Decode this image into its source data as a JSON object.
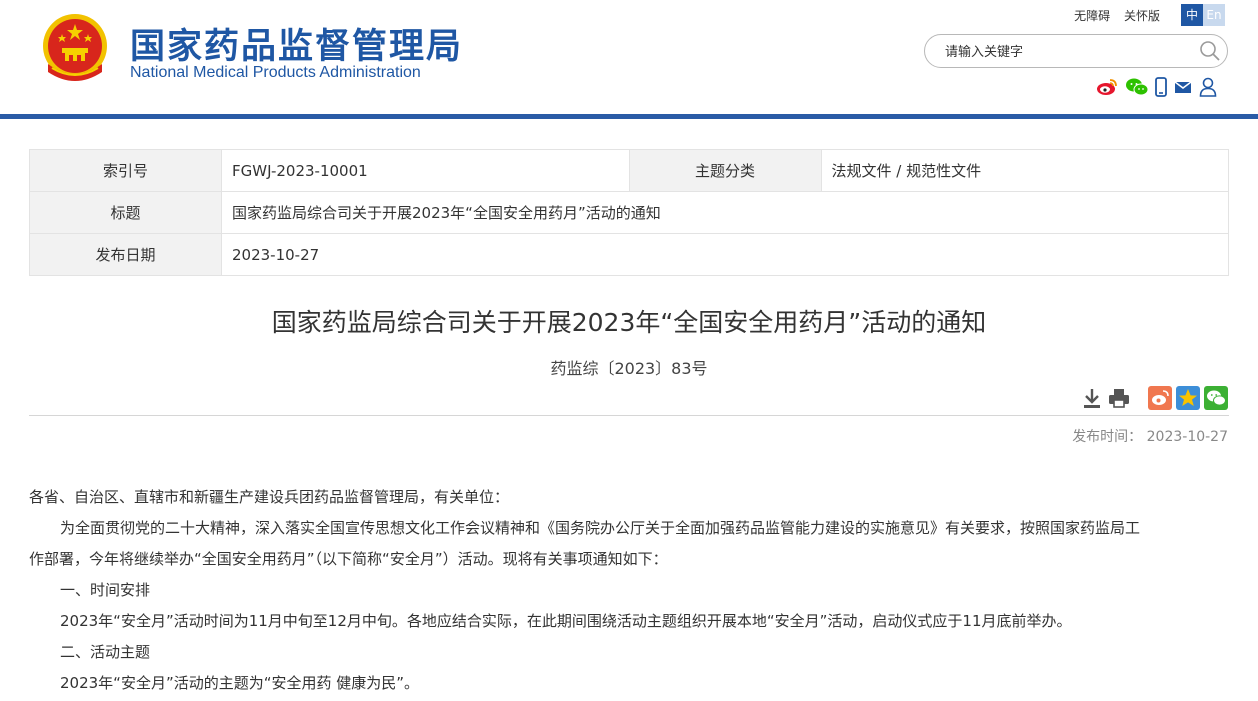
{
  "header": {
    "brand_cn": "国家药品监督管理局",
    "brand_en": "National Medical Products Administration",
    "top_links": [
      "无障碍",
      "关怀版"
    ],
    "lang_zh": "中",
    "lang_en": "En",
    "search_placeholder": "请输入关键字",
    "social_icons": [
      "weibo-icon",
      "wechat-icon",
      "mobile-icon",
      "mail-icon",
      "user-icon"
    ]
  },
  "info": {
    "index_label": "索引号",
    "index_value": "FGWJ-2023-10001",
    "category_label": "主题分类",
    "category_value": "法规文件 / 规范性文件",
    "title_label": "标题",
    "title_value": "国家药监局综合司关于开展2023年“全国安全用药月”活动的通知",
    "date_label": "发布日期",
    "date_value": "2023-10-27"
  },
  "article": {
    "title": "国家药监局综合司关于开展2023年“全国安全用药月”活动的通知",
    "doc_number": "药监综〔2023〕83号",
    "publish_time": "发布时间：  2023-10-27",
    "tools": [
      "download-icon",
      "print-icon",
      "share-weibo-icon",
      "share-qzone-icon",
      "share-wechat-icon"
    ],
    "paragraphs": {
      "p1": "各省、自治区、直辖市和新疆生产建设兵团药品监督管理局，有关单位：",
      "p2a": "为全面贯彻党的二十大精神，深入落实全国宣传思想文化工作会议精神和《国务院办公厅关于全面加强药品监管能力建设的实施意见》有关要求，按照国家药监局工",
      "p2b": "作部署，今年将继续举办“全国安全用药月”（以下简称“安全月”）活动。现将有关事项通知如下：",
      "p3": "一、时间安排",
      "p4": "2023年“安全月”活动时间为11月中旬至12月中旬。各地应结合实际，在此期间围绕活动主题组织开展本地“安全月”活动，启动仪式应于11月底前举办。",
      "p5": "二、活动主题",
      "p6": "2023年“安全月”活动的主题为“安全用药 健康为民”。"
    }
  },
  "colors": {
    "brand_blue": "#1f57a4",
    "header_bar": "#2a5ba6",
    "weibo_red": "#e6162d",
    "wechat_green": "#2dc100"
  }
}
